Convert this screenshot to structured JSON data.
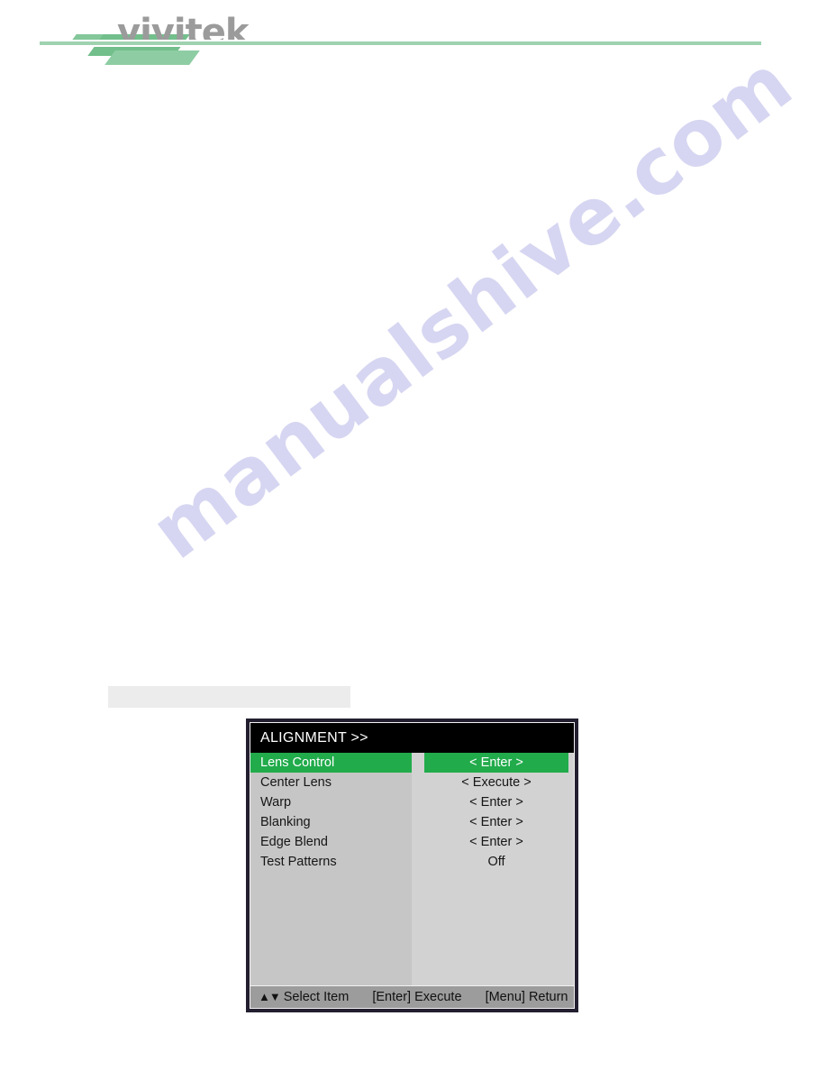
{
  "header": {
    "brand": "vivitek",
    "logo_icon": "vivitek-swoosh-logo"
  },
  "watermark": {
    "text": "manualshive.com"
  },
  "caption": {
    "text": ""
  },
  "osd": {
    "title": "ALIGNMENT >>",
    "selected_index": 0,
    "accent_color": "#21ab4b",
    "title_bg": "#000000",
    "panel_left_color": "#c6c6c6",
    "panel_right_color": "#d2d2d2",
    "footer_bg": "#9c9c9c",
    "border_color": "#231f30",
    "items": [
      {
        "label": "Lens Control",
        "value": "< Enter >"
      },
      {
        "label": "Center Lens",
        "value": "< Execute >"
      },
      {
        "label": "Warp",
        "value": "< Enter >"
      },
      {
        "label": "Blanking",
        "value": "< Enter >"
      },
      {
        "label": "Edge Blend",
        "value": "< Enter >"
      },
      {
        "label": "Test Patterns",
        "value": "Off"
      }
    ],
    "footer": {
      "select_arrows": "▲▼",
      "select_label": "Select Item",
      "enter_key": "[Enter]",
      "enter_label": "Execute",
      "menu_key": "[Menu]",
      "menu_label": "Return"
    }
  }
}
